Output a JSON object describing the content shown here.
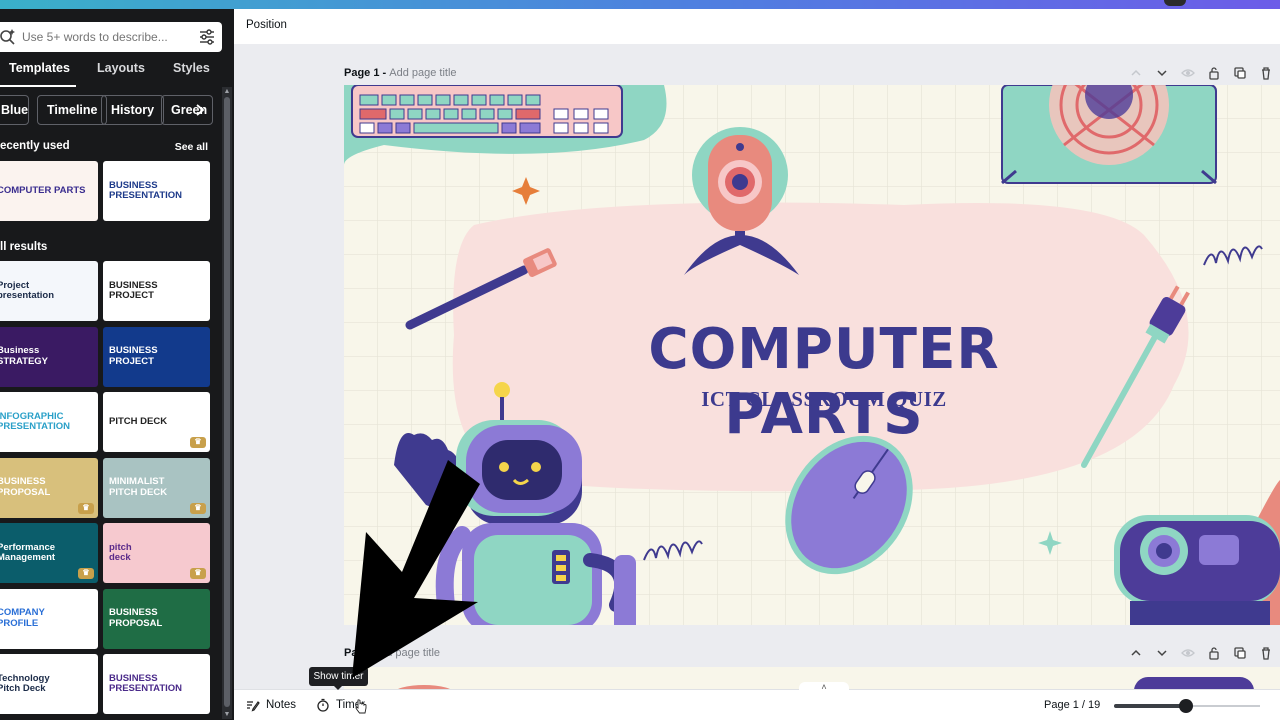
{
  "search": {
    "placeholder": "Use 5+ words to describe..."
  },
  "tabs": [
    "Templates",
    "Layouts",
    "Styles"
  ],
  "chips": [
    "Blue",
    "Timeline",
    "History",
    "Green"
  ],
  "sections": {
    "recent": "ecently used",
    "see_all": "See all",
    "results": "ll results"
  },
  "thumbnails": {
    "recent": [
      {
        "text": "COMPUTER PARTS",
        "bg": "#fbf3ef",
        "fg": "#3a2d8f"
      },
      {
        "text": "BUSINESS\nPRESENTATION",
        "bg": "#ffffff",
        "fg": "#1d3a8a"
      }
    ],
    "results": [
      {
        "text": "Project\npresentation",
        "bg": "#f4f7fb",
        "fg": "#1b2b48"
      },
      {
        "text": "BUSINESS\nPROJECT",
        "bg": "#ffffff",
        "fg": "#222"
      },
      {
        "text": "Business\nSTRATEGY",
        "bg": "#3a1a63",
        "fg": "#ffffff"
      },
      {
        "text": "BUSINESS\nPROJECT",
        "bg": "#123a8c",
        "fg": "#ffffff"
      },
      {
        "text": "INFOGRAPHIC\nPRESENTATION",
        "bg": "#ffffff",
        "fg": "#2aa0c8"
      },
      {
        "text": "PITCH DECK",
        "bg": "#ffffff",
        "fg": "#222",
        "premium": true
      },
      {
        "text": "BUSINESS\nPROPOSAL",
        "bg": "#d8c07c",
        "fg": "#ffffff",
        "premium": true
      },
      {
        "text": "MINIMALIST\nPITCH DECK",
        "bg": "#a9c3c2",
        "fg": "#ffffff",
        "premium": true
      },
      {
        "text": "Performance\nManagement",
        "bg": "#0b5d6b",
        "fg": "#ffffff",
        "premium": true
      },
      {
        "text": "pitch\ndeck",
        "bg": "#f6c9cf",
        "fg": "#5a2a8a",
        "premium": true
      },
      {
        "text": "COMPANY\nPROFILE",
        "bg": "#ffffff",
        "fg": "#2a6fd6"
      },
      {
        "text": "BUSINESS\nPROPOSAL",
        "bg": "#1f6d45",
        "fg": "#ffffff"
      },
      {
        "text": "Technology\nPitch Deck",
        "bg": "#ffffff",
        "fg": "#1b2b48"
      },
      {
        "text": "BUSINESS\nPRESENTATION",
        "bg": "#ffffff",
        "fg": "#4a2a8a"
      }
    ]
  },
  "toolbar": {
    "position_label": "Position"
  },
  "pages": [
    {
      "label": "Page 1 - ",
      "add": "Add page title"
    },
    {
      "label": "Page",
      "add": "Add page title"
    }
  ],
  "slide": {
    "title": "COMPUTER PARTS",
    "subtitle": "ICT CLASSROOM QUIZ"
  },
  "bottombar": {
    "notes": "Notes",
    "timer": "Timer",
    "page_count": "Page 1 / 19",
    "zoom_fraction": 0.5
  },
  "tooltip": {
    "text": "Show timer"
  },
  "colors": {
    "panel": "#18191b",
    "accent_purple": "#3c3a8e",
    "slide_bg": "#f8f6ea"
  }
}
